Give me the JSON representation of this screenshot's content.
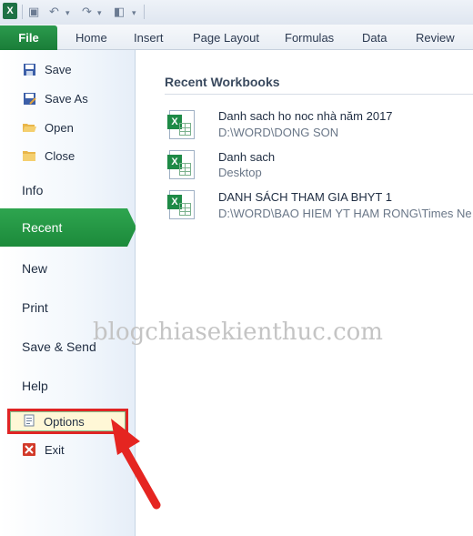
{
  "ribbon": {
    "file_label": "File",
    "tabs": [
      "Home",
      "Insert",
      "Page Layout",
      "Formulas",
      "Data",
      "Review"
    ]
  },
  "nav": {
    "save": "Save",
    "save_as": "Save As",
    "open": "Open",
    "close": "Close",
    "info": "Info",
    "recent": "Recent",
    "new": "New",
    "print": "Print",
    "save_send": "Save & Send",
    "help": "Help",
    "options": "Options",
    "exit": "Exit"
  },
  "main": {
    "title": "Recent Workbooks",
    "workbooks": [
      {
        "name": "Danh sach ho noc nhà năm 2017",
        "path": "D:\\WORD\\DONG SON"
      },
      {
        "name": "Danh sach",
        "path": "Desktop"
      },
      {
        "name": "DANH SÁCH THAM GIA BHYT 1",
        "path": "D:\\WORD\\BAO HIEM YT HAM RONG\\Times Ne"
      }
    ]
  },
  "watermark": "blogchiasekienthuc.com",
  "colors": {
    "accent": "#1c8a3b",
    "highlight": "#e02424"
  }
}
